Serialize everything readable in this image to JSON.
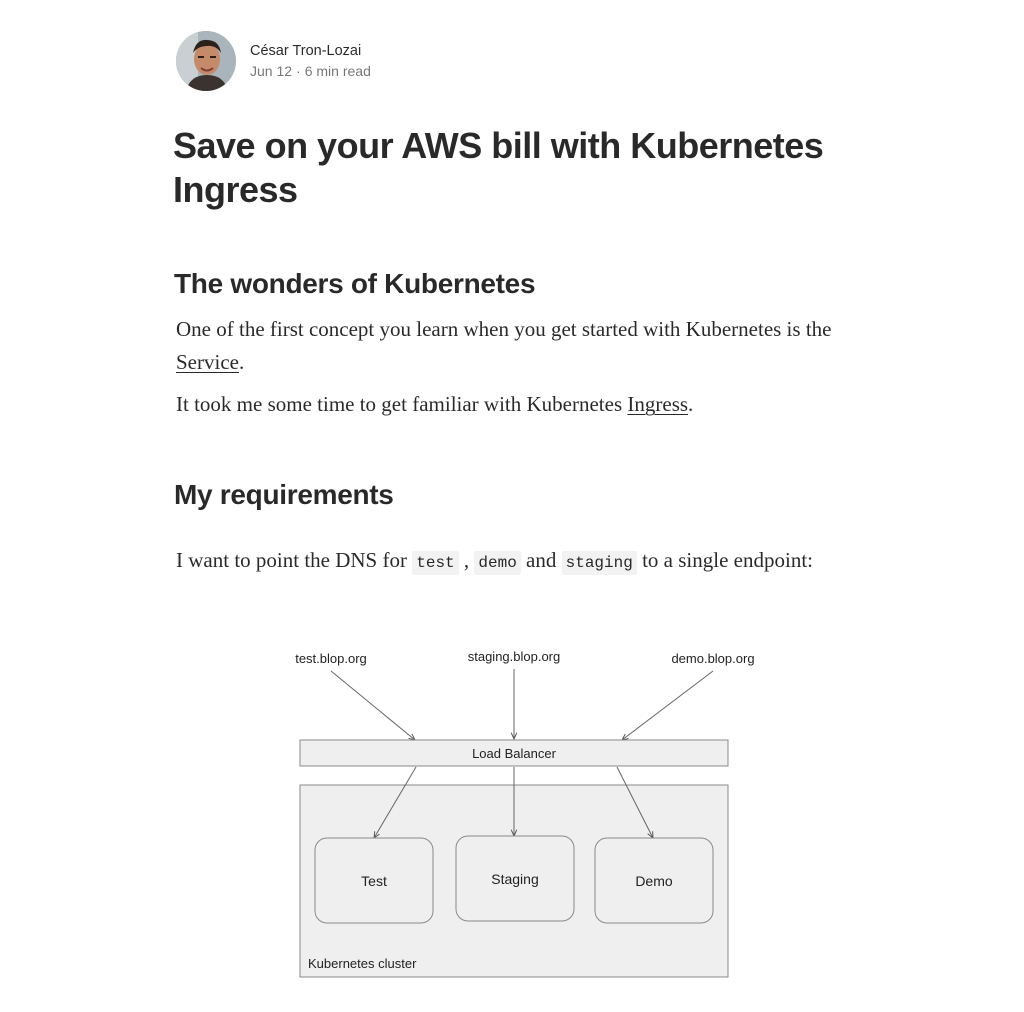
{
  "author": {
    "name": "César Tron-Lozai",
    "date": "Jun 12",
    "separator": "·",
    "read_time": "6 min read"
  },
  "article": {
    "title": "Save on your AWS bill with Kubernetes Ingress",
    "section1": {
      "heading": "The wonders of Kubernetes",
      "p1_text": "One of the first concept you learn when you get started with Kubernetes is the ",
      "p1_link": "Service",
      "p1_end": ".",
      "p2_text": "It took me some time to get familiar with Kubernetes ",
      "p2_link": "Ingress",
      "p2_end": "."
    },
    "section2": {
      "heading": "My requirements",
      "p_text": "I want to point the DNS for ",
      "code1": "test",
      "sep1": " , ",
      "code2": "demo",
      "sep2": " and ",
      "code3": "staging",
      "p_end": " to a single endpoint:"
    }
  },
  "diagram": {
    "dns_test": "test.blop.org",
    "dns_staging": "staging.blop.org",
    "dns_demo": "demo.blop.org",
    "load_balancer": "Load Balancer",
    "svc_test": "Test",
    "svc_staging": "Staging",
    "svc_demo": "Demo",
    "cluster_label": "Kubernetes cluster"
  },
  "colors": {
    "box_fill": "#efefef",
    "box_stroke": "#8a8a8a",
    "text": "rgba(0,0,0,0.84)"
  }
}
